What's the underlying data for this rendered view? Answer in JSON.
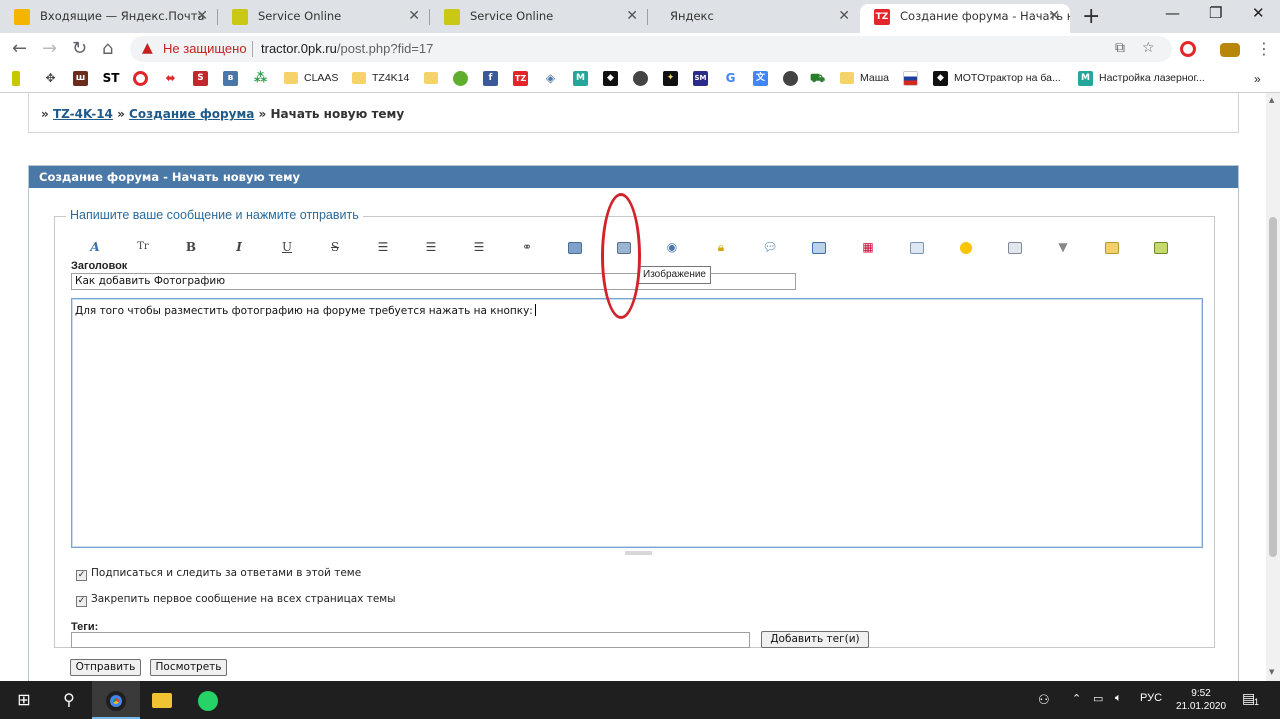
{
  "browser": {
    "tabs": [
      {
        "title": "Входящие — Яндекс.Почта",
        "color": "#f5b400"
      },
      {
        "title": "Service Online",
        "color": "#c9c915"
      },
      {
        "title": "Service Online",
        "color": "#c9c915"
      },
      {
        "title": "Яндекс",
        "color": ""
      },
      {
        "title": "Создание форума - Начать нову",
        "color": "#e2262a",
        "favicon_text": "TZ"
      }
    ],
    "security_label": "Не защищено",
    "url_host": "tractor.0pk.ru",
    "url_path": "/post.php?fid=17"
  },
  "bookmarks": [
    {
      "label": "CLAAS"
    },
    {
      "label": "TZ4K14"
    },
    {
      "label": "Маша"
    },
    {
      "label": "MOTOтрактор на ба..."
    },
    {
      "label": "Настройка лазерног..."
    }
  ],
  "bookmark_icons": {
    "st": "ST",
    "s": "S",
    "tz": "TZ",
    "m": "M",
    "g": "G",
    "sm": "SM",
    "w": "ш"
  },
  "breadcrumb": {
    "prefix": "»",
    "link1": "TZ-4K-14",
    "sep": "»",
    "link2": "Создание форума",
    "current": "» Начать новую тему"
  },
  "panel": {
    "header": "Создание форума - Начать новую тему",
    "legend": "Напишите ваше сообщение и нажмите отправить"
  },
  "editor": {
    "toolbar_glyphs": {
      "font": "A",
      "size": "Tr",
      "bold": "B",
      "italic": "I",
      "underline": "U",
      "strike": "S"
    },
    "tooltip": "Изображение",
    "title_label": "Заголовок",
    "title_value": "Как добавить Фотографию",
    "body_value": "Для того чтобы разместить фотографию на форуме требуется нажать на кнопку:",
    "subscribe_label": "Подписаться и следить за ответами в этой теме",
    "pin_label": "Закрепить первое сообщение на всех страницах темы",
    "tags_label": "Теги:",
    "add_tag_button": "Добавить тег(и)",
    "submit_button": "Отправить",
    "preview_button": "Посмотреть"
  },
  "taskbar": {
    "lang": "РУС",
    "time": "9:52",
    "date": "21.01.2020",
    "notifications": "1"
  },
  "colors": {
    "panel_header": "#4a79a8",
    "link": "#1f5a8a",
    "annotation": "#d2232a"
  }
}
